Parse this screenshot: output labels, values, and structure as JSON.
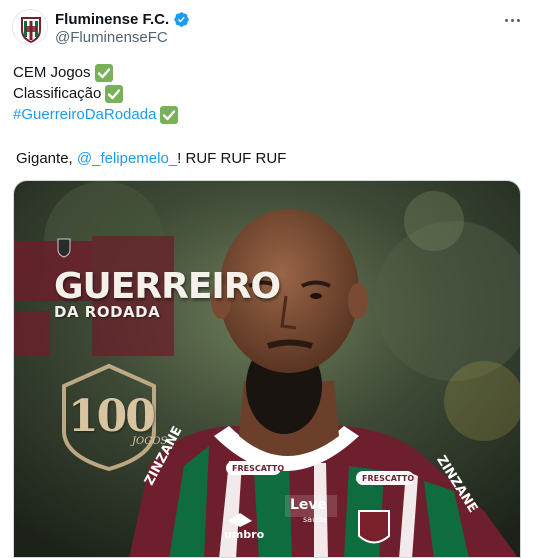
{
  "author": {
    "display_name": "Fluminense F.C.",
    "handle": "@FluminenseFC",
    "avatar_icon": "fluminense-crest-icon",
    "verified_icon": "verified-badge-icon",
    "verified_color": "#1d9bf0"
  },
  "tweet": {
    "line1": "CEM Jogos",
    "line2": "Classificação",
    "hashtag": "#GuerreiroDaRodada",
    "gigante_prefix": "Gigante, ",
    "mention": "@_felipemelo_",
    "gigante_suffix": "! RUF RUF RUF",
    "check_icon": "check-mark-emoji-icon",
    "link_color": "#1d9bf0"
  },
  "media": {
    "title": "GUERREIRO",
    "subtitle": "DA RODADA",
    "badge_number": "100",
    "badge_label": "JOGOS",
    "shirt_sponsor_left": "ZINZANE",
    "shirt_sponsor_right": "ZINZANE",
    "shirt_frescatto_left": "FRESCATTO",
    "shirt_frescatto_right": "FRESCATTO",
    "shirt_leve": "Leve",
    "shirt_saude": "saúde",
    "shirt_umbro": "umbro"
  },
  "menu": {
    "more_icon": "more-options-icon"
  }
}
